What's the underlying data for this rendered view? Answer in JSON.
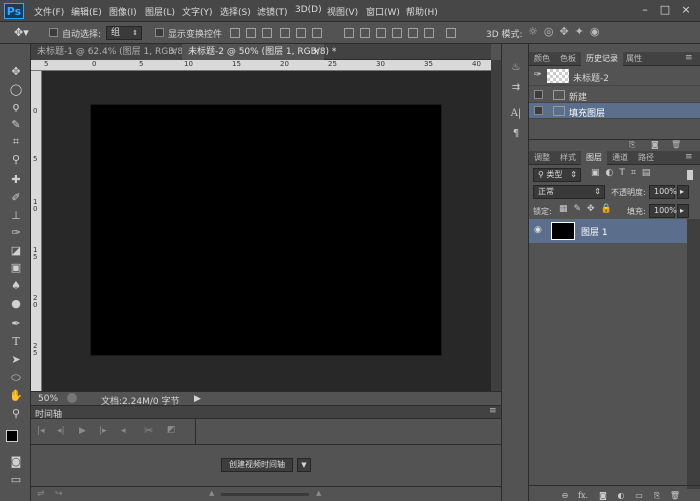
{
  "app": {
    "logo": "Ps"
  },
  "menu": [
    "文件(F)",
    "编辑(E)",
    "图像(I)",
    "图层(L)",
    "文字(Y)",
    "选择(S)",
    "滤镜(T)",
    "3D(D)",
    "视图(V)",
    "窗口(W)",
    "帮助(H)"
  ],
  "window_controls": {
    "minimize": "–",
    "maximize": "□",
    "close": "×"
  },
  "options": {
    "auto_select_label": "自动选择:",
    "auto_select_value": "组",
    "show_transform_label": "显示变换控件",
    "mode_3d_label": "3D 模式:"
  },
  "tabs": [
    {
      "label": "未标题-1 @ 62.4% (图层 1, RGB/8) *",
      "close": "×",
      "active": false
    },
    {
      "label": "未标题-2 @ 50% (图层 1, RGB/8) *",
      "close": "×",
      "active": true
    }
  ],
  "ruler": {
    "top_labels": [
      "5",
      "0",
      "5",
      "10",
      "15",
      "20",
      "25",
      "30",
      "35",
      "40"
    ],
    "left_labels": [
      "0",
      "5",
      "1\n0",
      "1\n5",
      "2\n0",
      "2\n5"
    ]
  },
  "status": {
    "zoom": "50%",
    "doc_info": "文档:2.24M/0 字节",
    "arrow": "▶"
  },
  "timeline": {
    "title": "时间轴",
    "create_button": "创建视频时间轴",
    "dropdown_arrow": "▼"
  },
  "panels": {
    "top_tabs": [
      "颜色",
      "色板",
      "历史记录",
      "属性"
    ],
    "top_active": "历史记录",
    "history_snapshot": "未标题-2",
    "history_items": [
      "新建",
      "填充图层"
    ],
    "history_selected": "填充图层",
    "layers_tabs": [
      "调整",
      "样式",
      "图层",
      "通道",
      "路径"
    ],
    "layers_active": "图层",
    "filter_kind": "类型",
    "blend_mode": "正常",
    "opacity_label": "不透明度:",
    "opacity_value": "100%",
    "lock_label": "锁定:",
    "fill_label": "填充:",
    "fill_value": "100%",
    "layer_name": "图层 1",
    "fx_label": "fx."
  },
  "colors": {
    "ui_dark": "#535353",
    "canvas": "#000000",
    "pasteboard": "#282828",
    "selection": "#5b6f8d",
    "ps_blue": "#31a8ff"
  }
}
